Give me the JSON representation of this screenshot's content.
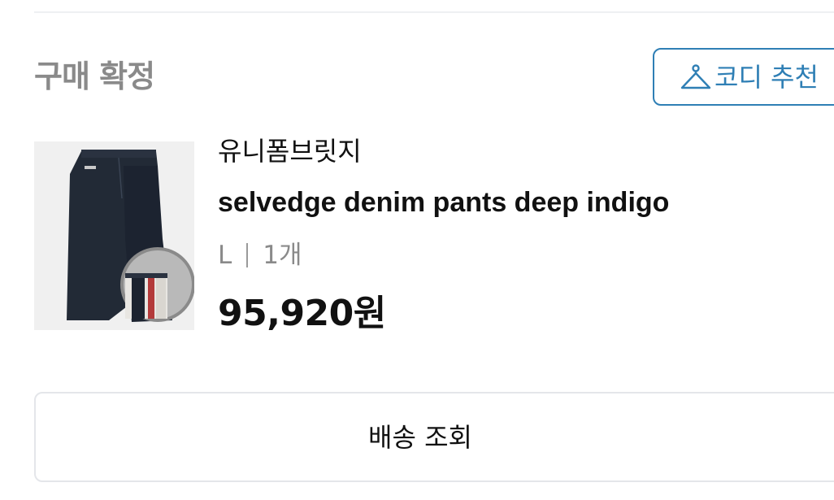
{
  "order": {
    "status": "구매 확정",
    "codi_button_label": "코디 추천"
  },
  "product": {
    "brand": "유니폼브릿지",
    "name": "selvedge denim pants deep indigo",
    "size": "L",
    "quantity": "1개",
    "price": "95,920원",
    "image_description": "dark indigo selvedge jeans"
  },
  "actions": {
    "track_delivery_label": "배송 조회"
  },
  "colors": {
    "accent": "#2f7fb5",
    "status_text": "#8a8a8a"
  }
}
